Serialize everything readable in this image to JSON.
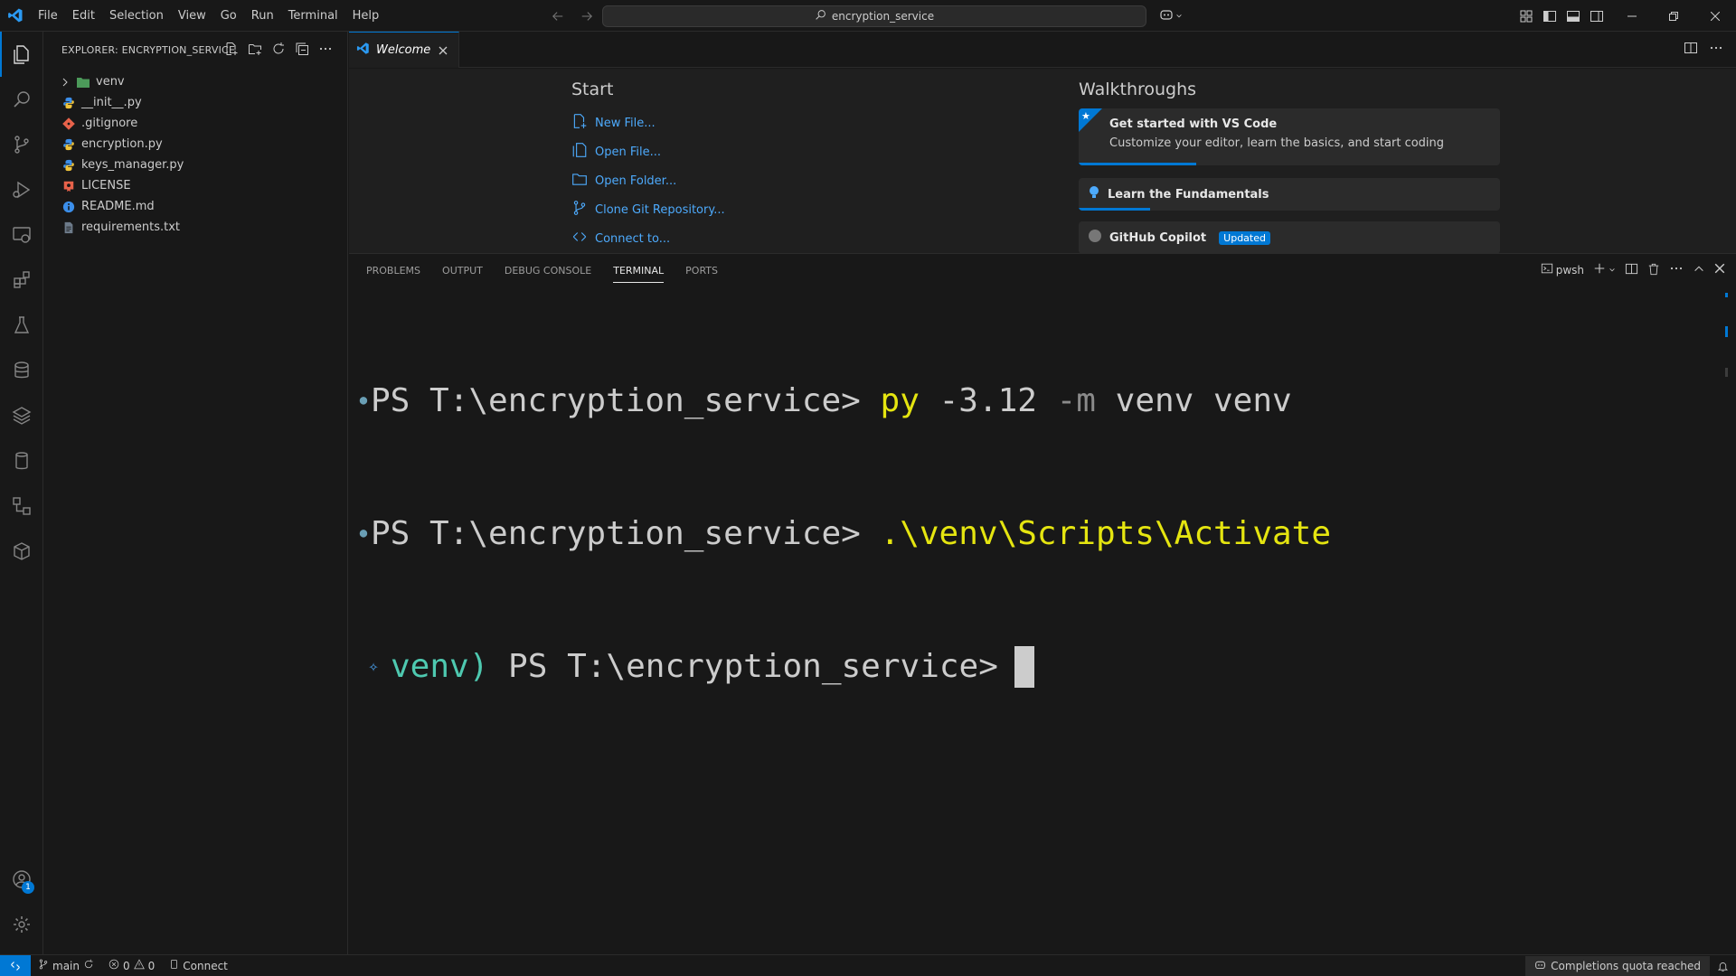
{
  "titlebar": {
    "menu": [
      "File",
      "Edit",
      "Selection",
      "View",
      "Go",
      "Run",
      "Terminal",
      "Help"
    ],
    "search_text": "encryption_service"
  },
  "sidebar": {
    "title": "EXPLORER: ENCRYPTION_SERVICE",
    "files": [
      {
        "name": "venv",
        "type": "folder",
        "color": "#4c9a5a"
      },
      {
        "name": "__init__.py",
        "type": "python",
        "color": "#3b8eea"
      },
      {
        "name": ".gitignore",
        "type": "git",
        "color": "#e8624a"
      },
      {
        "name": "encryption.py",
        "type": "python",
        "color": "#3b8eea"
      },
      {
        "name": "keys_manager.py",
        "type": "python",
        "color": "#3b8eea"
      },
      {
        "name": "LICENSE",
        "type": "license",
        "color": "#e8624a"
      },
      {
        "name": "README.md",
        "type": "info",
        "color": "#3b8eea"
      },
      {
        "name": "requirements.txt",
        "type": "text",
        "color": "#8a8a8a"
      }
    ]
  },
  "tabs": [
    {
      "label": "Welcome"
    }
  ],
  "welcome": {
    "start_title": "Start",
    "start_links": [
      "New File...",
      "Open File...",
      "Open Folder...",
      "Clone Git Repository...",
      "Connect to..."
    ],
    "walkthroughs_title": "Walkthroughs",
    "walk1_title": "Get started with VS Code",
    "walk1_desc": "Customize your editor, learn the basics, and start coding",
    "walk1_progress": 0.28,
    "walk2_title": "Learn the Fundamentals",
    "walk2_progress": 0.17,
    "walk3_title": "GitHub Copilot",
    "walk3_badge": "Updated"
  },
  "panel": {
    "tabs": [
      "PROBLEMS",
      "OUTPUT",
      "DEBUG CONSOLE",
      "TERMINAL",
      "PORTS"
    ],
    "active_tab": "TERMINAL",
    "shell_label": "pwsh"
  },
  "terminal": {
    "line1_prompt": "PS T:\\encryption_service> ",
    "line1_cmd": "py",
    "line1_arg1": " -3.12 ",
    "line1_flag": "-m",
    "line1_rest": " venv venv",
    "line2_prompt": "PS T:\\encryption_service> ",
    "line2_cmd": ".\\venv\\Scripts\\Activate",
    "line3_env": "venv)",
    "line3_prompt": " PS T:\\encryption_service>"
  },
  "statusbar": {
    "branch": "main",
    "errors": "0",
    "warnings": "0",
    "connect": "Connect",
    "quota": "Completions quota reached"
  },
  "accounts_badge": "1",
  "colors": {
    "accent": "#0078d4",
    "link": "#4daafc",
    "terminal_yellow": "#e5e510",
    "terminal_green": "#4ec9b0"
  }
}
